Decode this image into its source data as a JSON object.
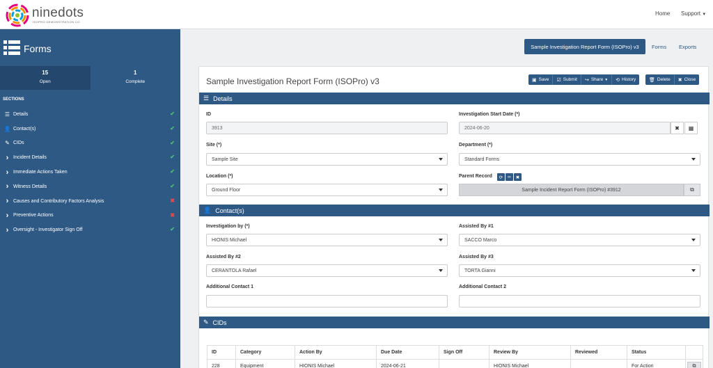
{
  "brand": {
    "name": "ninedots",
    "subtitle": "ISOPRO DEMONSTRATION CO."
  },
  "topnav": {
    "home": "Home",
    "support": "Support"
  },
  "sidebar": {
    "title": "Forms",
    "counts": [
      {
        "value": "15",
        "label": "Open"
      },
      {
        "value": "1",
        "label": "Complete"
      }
    ],
    "sections_label": "SECTIONS",
    "items": [
      {
        "label": "Details",
        "icon": "list-icon",
        "status": "ok"
      },
      {
        "label": "Contact(s)",
        "icon": "user-icon",
        "status": "ok"
      },
      {
        "label": "CIDs",
        "icon": "edit-icon",
        "status": "ok"
      },
      {
        "label": "Incident Details",
        "icon": "chevron-right-icon",
        "status": "ok"
      },
      {
        "label": "Immediate Actions Taken",
        "icon": "chevron-right-icon",
        "status": "ok"
      },
      {
        "label": "Witness Details",
        "icon": "chevron-right-icon",
        "status": "ok"
      },
      {
        "label": "Causes and Contributory Factors Analysis",
        "icon": "chevron-right-icon",
        "status": "bad"
      },
      {
        "label": "Preventive Actions",
        "icon": "chevron-right-icon",
        "status": "bad"
      },
      {
        "label": "Oversight - Investigator Sign Off",
        "icon": "chevron-right-icon",
        "status": "ok"
      }
    ]
  },
  "header": {
    "active_form": "Sample Investigation Report Form (ISOPro) v3",
    "forms_link": "Forms",
    "exports_link": "Exports"
  },
  "form": {
    "title": "Sample Investigation Report Form (ISOPro) v3",
    "actions": {
      "save": "Save",
      "submit": "Submit",
      "share": "Share",
      "history": "History",
      "delete": "Delete",
      "close": "Close"
    },
    "details": {
      "heading": "Details",
      "id_label": "ID",
      "id_value": "3913",
      "start_date_label": "Investigation Start Date (*)",
      "start_date_value": "2024-06-20",
      "site_label": "Site (*)",
      "site_value": "Sample Site",
      "department_label": "Department (*)",
      "department_value": "Standard Forms",
      "location_label": "Location (*)",
      "location_value": "Ground Floor",
      "parent_label": "Parent Record",
      "parent_value": "Sample Incident Report Form (ISOPro) #3912"
    },
    "contacts": {
      "heading": "Contact(s)",
      "investigation_by_label": "Investigation by (*)",
      "investigation_by_value": "HIONIS Michael",
      "assisted1_label": "Assisted By #1",
      "assisted1_value": "SACCO Marco",
      "assisted2_label": "Assisted By #2",
      "assisted2_value": "CERANTOLA Rafael",
      "assisted3_label": "Assisted By #3",
      "assisted3_value": "TORTA Gianni",
      "additional1_label": "Additional Contact 1",
      "additional1_value": "",
      "additional2_label": "Additional Contact 2",
      "additional2_value": ""
    },
    "cids": {
      "heading": "CIDs",
      "columns": [
        "ID",
        "Category",
        "Action By",
        "Due Date",
        "Sign Off",
        "Review By",
        "Reviewed",
        "Status"
      ],
      "rows": [
        [
          "228",
          "Equipment",
          "HIONIS Michael",
          "2024-06-21",
          "",
          "HIONIS Michael",
          "",
          "For Action"
        ]
      ]
    }
  },
  "colors": {
    "primary": "#2e5985",
    "ok": "#4cc26f",
    "bad": "#e24c4c"
  }
}
